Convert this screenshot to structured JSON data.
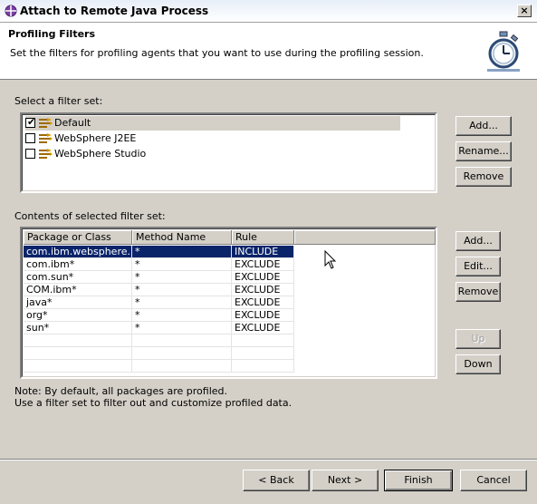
{
  "window": {
    "title": "Attach to Remote Java Process",
    "close_glyph": "×"
  },
  "header": {
    "title": "Profiling Filters",
    "description": "Set the filters for profiling agents that you want to use during the profiling session.",
    "graphic_icon": "stopwatch-icon"
  },
  "filter_sets": {
    "label": "Select a filter set:",
    "items": [
      {
        "label": "Default",
        "checked": true,
        "selected": true
      },
      {
        "label": "WebSphere J2EE",
        "checked": false,
        "selected": false
      },
      {
        "label": "WebSphere Studio",
        "checked": false,
        "selected": false
      }
    ],
    "buttons": {
      "add": "Add...",
      "rename": "Rename...",
      "remove": "Remove"
    }
  },
  "contents": {
    "label": "Contents of selected filter set:",
    "columns": [
      "Package or Class",
      "Method Name",
      "Rule"
    ],
    "rows": [
      [
        "com.ibm.websphere.....",
        "*",
        "INCLUDE"
      ],
      [
        "com.ibm*",
        "*",
        "EXCLUDE"
      ],
      [
        "com.sun*",
        "*",
        "EXCLUDE"
      ],
      [
        "COM.ibm*",
        "*",
        "EXCLUDE"
      ],
      [
        "java*",
        "*",
        "EXCLUDE"
      ],
      [
        "org*",
        "*",
        "EXCLUDE"
      ],
      [
        "sun*",
        "*",
        "EXCLUDE"
      ]
    ],
    "selected_row": 0,
    "buttons": {
      "add": "Add...",
      "edit": "Edit...",
      "remove": "Remove",
      "up": "Up",
      "down": "Down"
    }
  },
  "notes": {
    "line1": "Note: By default, all packages are profiled.",
    "line2": "Use a filter set to filter out and customize profiled data."
  },
  "footer": {
    "back": "< Back",
    "next": "Next >",
    "finish": "Finish",
    "cancel": "Cancel"
  },
  "colors": {
    "selection": "#0a246a",
    "dialog_bg": "#d4d0c8"
  }
}
